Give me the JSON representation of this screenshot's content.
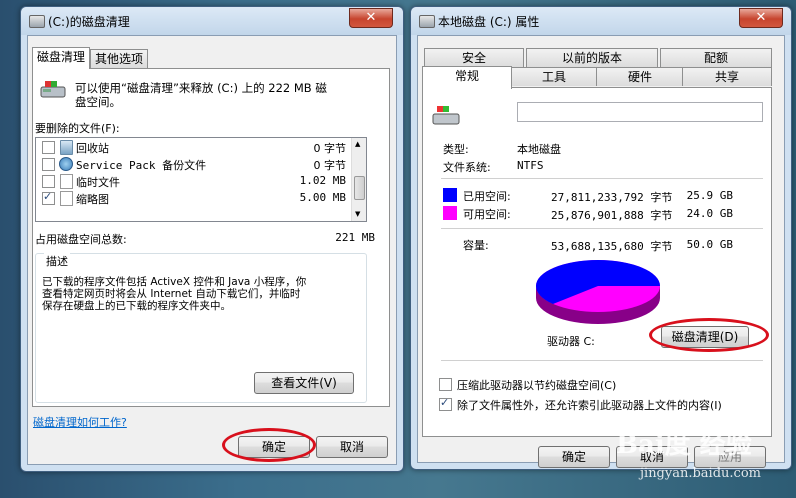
{
  "left_window": {
    "title": "(C:)的磁盘清理",
    "close": "✕",
    "tabs": [
      "磁盘清理",
      "其他选项"
    ],
    "intro": [
      "可以使用“磁盘清理”来释放  (C:) 上的 222 MB 磁",
      "盘空间。"
    ],
    "files_label": "要删除的文件(F):",
    "files": [
      {
        "name": "回收站",
        "size": "0 字节",
        "checked": false,
        "icon": "recycle-bin-icon"
      },
      {
        "name": "Service Pack 备份文件",
        "size": "0 字节",
        "checked": false,
        "icon": "backup-icon"
      },
      {
        "name": "临时文件",
        "size": "1.02 MB",
        "checked": false,
        "icon": "file-icon"
      },
      {
        "name": "缩略图",
        "size": "5.00 MB",
        "checked": true,
        "icon": "file-icon"
      }
    ],
    "total_label": "占用磁盘空间总数:",
    "total_value": "221 MB",
    "description_label": "描述",
    "description": [
      "已下载的程序文件包括 ActiveX 控件和 Java 小程序，你",
      "查看特定网页时将会从 Internet 自动下载它们，并临时",
      "保存在硬盘上的已下载的程序文件夹中。"
    ],
    "view_files_button": "查看文件(V)",
    "how_link": "磁盘清理如何工作?",
    "ok_button": "确定",
    "cancel_button": "取消"
  },
  "right_window": {
    "title": "本地磁盘 (C:) 属性",
    "close": "✕",
    "tabs_top": [
      "安全",
      "以前的版本",
      "配额"
    ],
    "tabs_bottom": [
      "常规",
      "工具",
      "硬件",
      "共享"
    ],
    "type_label": "类型:",
    "type_value": "本地磁盘",
    "fs_label": "文件系统:",
    "fs_value": "NTFS",
    "used_label": "已用空间:",
    "used_bytes": "27,811,233,792 字节",
    "used_gb": "25.9 GB",
    "free_label": "可用空间:",
    "free_bytes": "25,876,901,888 字节",
    "free_gb": "24.0 GB",
    "capacity_label": "容量:",
    "capacity_bytes": "53,688,135,680 字节",
    "capacity_gb": "50.0 GB",
    "drive_label": "驱动器 C:",
    "cleanup_button": "磁盘清理(D)",
    "compress_label": "压缩此驱动器以节约磁盘空间(C)",
    "compress_checked": false,
    "index_label": "除了文件属性外，还允许索引此驱动器上文件的内容(I)",
    "index_checked": true,
    "ok_button": "确定",
    "cancel_button": "取消",
    "apply_button": "应用"
  },
  "watermark": {
    "text": "Bai度 经验",
    "url": "jingyan.baidu.com"
  },
  "colors": {
    "used": "#0000ff",
    "free": "#ff00ff",
    "highlight": "#d8101c"
  }
}
